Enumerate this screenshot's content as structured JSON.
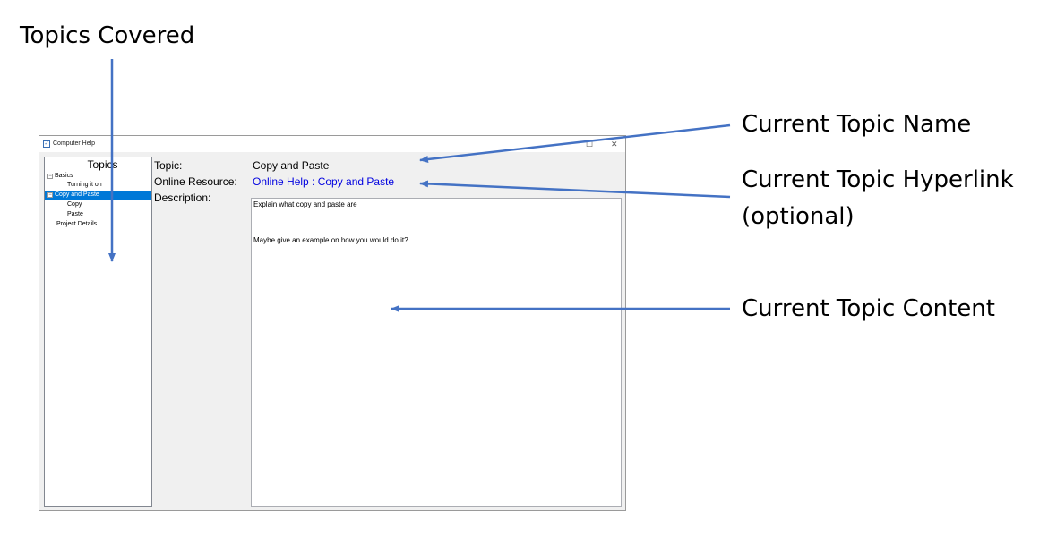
{
  "callouts": {
    "topics_covered": "Topics Covered",
    "topic_name": "Current Topic Name",
    "topic_hyperlink_line1": "Current Topic Hyperlink",
    "topic_hyperlink_line2": "(optional)",
    "topic_content": "Current Topic Content"
  },
  "window": {
    "title": "Computer Help",
    "icon": "checkbox-icon",
    "maximize_glyph": "☐",
    "close_glyph": "✕"
  },
  "tree": {
    "header": "Topics",
    "items": [
      {
        "label": "Basics",
        "expander": "⊟",
        "selected": false
      },
      {
        "label": "Turning it on",
        "selected": false
      },
      {
        "label": "Copy and Paste",
        "expander": "⊟",
        "selected": true
      },
      {
        "label": "Copy",
        "selected": false
      },
      {
        "label": "Paste",
        "selected": false
      },
      {
        "label": "Project Details",
        "selected": false
      }
    ]
  },
  "fields": {
    "topic_label": "Topic:",
    "topic_value": "Copy and Paste",
    "resource_label": "Online Resource:",
    "resource_value": "Online Help : Copy and Paste",
    "description_label": "Description:",
    "description_lines": [
      "Explain what copy and paste are",
      "",
      "",
      "",
      "Maybe give an example on how you would do it?"
    ]
  },
  "colors": {
    "arrow": "#4472c4",
    "selection": "#0078d7",
    "link": "#0000e0"
  }
}
